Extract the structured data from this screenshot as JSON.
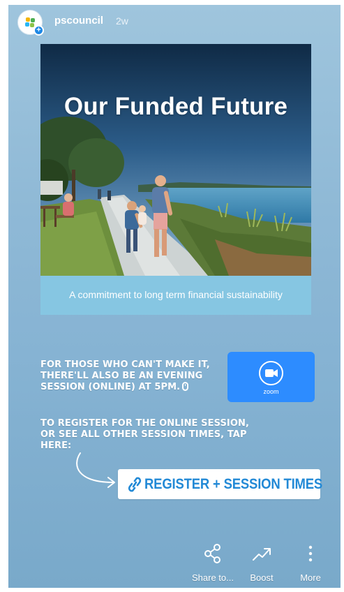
{
  "header": {
    "username": "pscouncil",
    "time_ago": "2w",
    "add_badge": "+"
  },
  "post": {
    "title": "Our Funded Future",
    "caption": "A commitment to long term financial sustainability"
  },
  "story_text": {
    "evening_session": "FOR THOSE WHO CAN'T MAKE IT, THERE'LL ALSO BE AN EVENING SESSION (ONLINE) AT 5PM.",
    "register_prompt": "TO REGISTER FOR THE ONLINE SESSION, OR SEE ALL OTHER SESSION TIMES, TAP HERE:"
  },
  "zoom_sticker": {
    "label": "zoom",
    "color": "#2d8cff"
  },
  "link_sticker": {
    "label": "REGISTER + SESSION TIMES",
    "icon": "link-icon",
    "color": "#2289d6"
  },
  "actions": [
    {
      "label": "Share to...",
      "icon": "share-icon"
    },
    {
      "label": "Boost",
      "icon": "boost-icon"
    },
    {
      "label": "More",
      "icon": "more-vertical-icon"
    }
  ]
}
